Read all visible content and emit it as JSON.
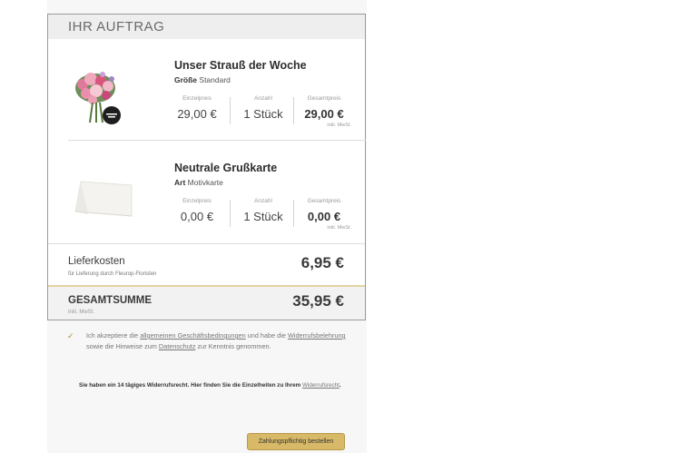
{
  "order": {
    "header_title": "IHR AUFTRAG",
    "items": [
      {
        "name": "Unser Strauß der Woche",
        "attr_label": "Größe",
        "attr_value": "Standard",
        "unit_price_label": "Einzelpreis",
        "unit_price": "29,00 €",
        "qty_label": "Anzahl",
        "qty": "1 Stück",
        "total_label": "Gesamtpreis",
        "total": "29,00 €",
        "total_note": "inkl. MwSt."
      },
      {
        "name": "Neutrale Grußkarte",
        "attr_label": "Art",
        "attr_value": "Motivkarte",
        "unit_price_label": "Einzelpreis",
        "unit_price": "0,00 €",
        "qty_label": "Anzahl",
        "qty": "1 Stück",
        "total_label": "Gesamtpreis",
        "total": "0,00 €",
        "total_note": "inkl. MwSt."
      }
    ],
    "shipping": {
      "label": "Lieferkosten",
      "sub": "für Lieferung durch Fleurop-Floristen",
      "value": "6,95 €"
    },
    "total": {
      "label": "GESAMTSUMME",
      "sub": "inkl. MwSt.",
      "value": "35,95 €"
    }
  },
  "agb": {
    "checked": true,
    "check_glyph": "✓",
    "text_1": "Ich akzeptiere die ",
    "link_agb": "allgemeinen Geschäftsbedingungen",
    "text_2": " und habe die ",
    "link_widerruf": "Widerrufsbelehrung",
    "text_3": " sowie die Hinweise zum ",
    "link_datenschutz": "Datenschutz",
    "text_4": " zur Kenntnis genommen."
  },
  "withdrawal": {
    "text": "Sie haben ein 14 tägiges Widerrufsrecht. Hier finden Sie die Einzelheiten zu Ihrem ",
    "link": "Widerrufsrecht",
    "text_end": "."
  },
  "submit": {
    "label": "Zahlungspflichtig bestellen"
  },
  "colors": {
    "accent_gold": "#d8b968",
    "total_border": "#e3d3a0"
  },
  "icons": {
    "bouquet": "flower-bouquet-image",
    "card": "greeting-card-image",
    "check": "checkmark-icon"
  }
}
